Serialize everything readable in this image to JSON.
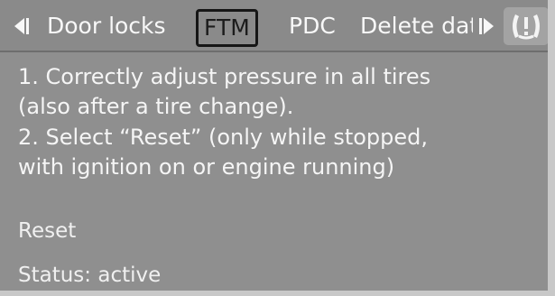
{
  "menu": {
    "items": [
      {
        "label": "Door locks"
      },
      {
        "label": "FTM",
        "selected": true
      },
      {
        "label": "PDC"
      },
      {
        "label": "Delete data"
      }
    ],
    "left_arrow_icon": "scroll-left-icon",
    "right_arrow_icon": "scroll-right-icon",
    "warning_icon": "tire-pressure-warning-icon"
  },
  "instructions": {
    "line1a": "1. Correctly adjust pressure in all tires",
    "line1b": "(also after a tire change).",
    "line2a": "2. Select “Reset” (only while stopped,",
    "line2b": "with ignition on or engine running)"
  },
  "reset_label": "Reset",
  "status": {
    "text": "Status: active"
  },
  "colors": {
    "background": "#8f8f8f",
    "text": "#f5f5f5",
    "selected_tab_border": "#161616"
  }
}
